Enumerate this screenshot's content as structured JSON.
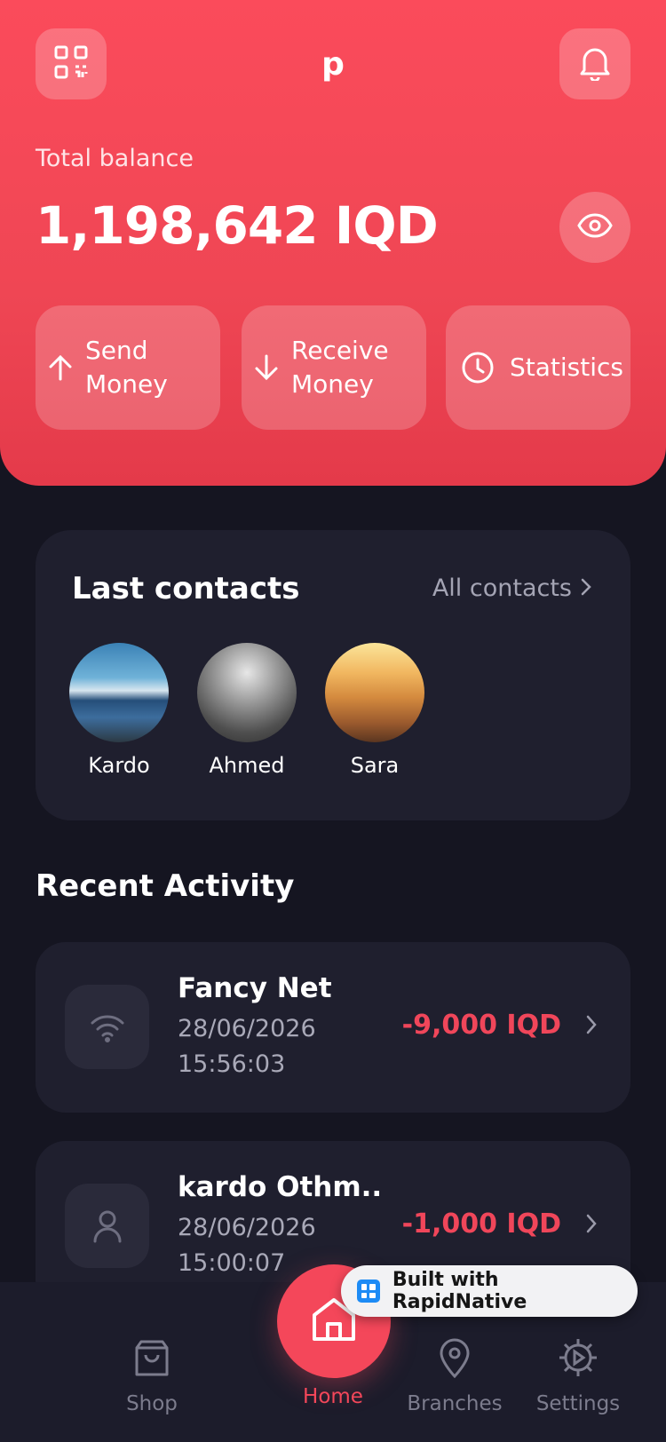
{
  "header": {
    "app_letter": "p",
    "balance_label": "Total balance",
    "balance_value": "1,198,642 IQD",
    "actions": [
      {
        "label": "Send\nMoney",
        "icon": "arrow-up-icon"
      },
      {
        "label": "Receive\nMoney",
        "icon": "arrow-down-icon"
      },
      {
        "label": "Statistics",
        "icon": "clock-icon"
      }
    ]
  },
  "contacts": {
    "title": "Last contacts",
    "all_link": "All contacts",
    "items": [
      {
        "name": "Kardo"
      },
      {
        "name": "Ahmed"
      },
      {
        "name": "Sara"
      }
    ]
  },
  "activity": {
    "title": "Recent Activity",
    "items": [
      {
        "name": "Fancy Net",
        "date": "28/06/2026",
        "time": "15:56:03",
        "amount": "-9,000 IQD",
        "icon": "wifi-icon"
      },
      {
        "name": "kardo Othm...",
        "date": "28/06/2026",
        "time": "15:00:07",
        "amount": "-1,000 IQD",
        "icon": "user-icon"
      }
    ]
  },
  "nav": {
    "shop": "Shop",
    "home": "Home",
    "branches": "Branches",
    "settings": "Settings"
  },
  "badge": {
    "text": "Built with RapidNative"
  },
  "colors": {
    "accent": "#f4475a",
    "background": "#151521",
    "card": "#1f1f2e"
  }
}
